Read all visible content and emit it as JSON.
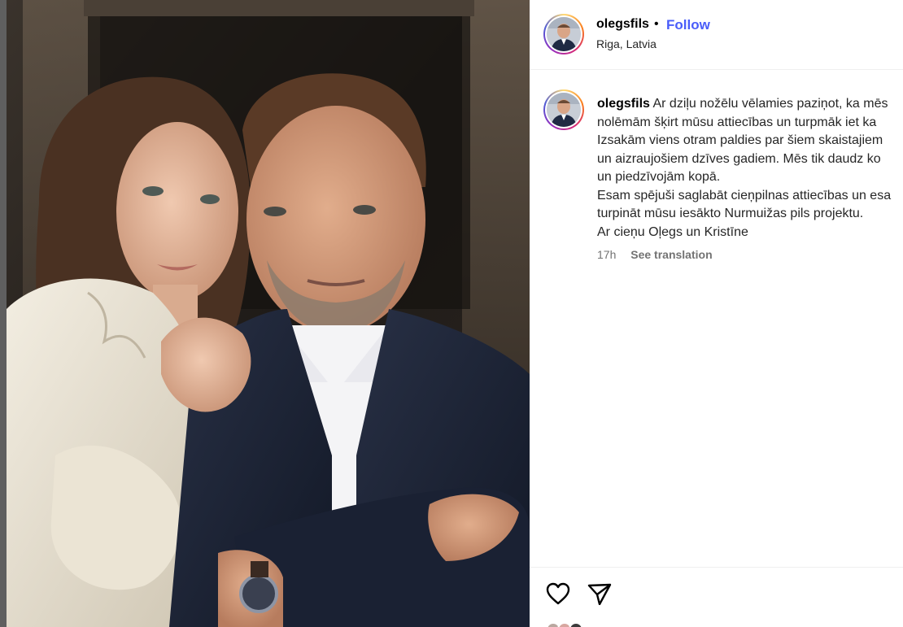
{
  "post": {
    "username": "olegsfils",
    "separator": "•",
    "follow_label": "Follow",
    "location": "Riga, Latvia",
    "caption_lines": [
      "Ar dziļu nožēlu vēlamies paziņot, ka mēs",
      "nolēmām šķirt mūsu attiecības un turpmāk iet ka",
      "Izsakām viens otram paldies par šiem skaistajiem",
      "un aizraujošiem dzīves gadiem. Mēs tik daudz ko",
      "un piedzīvojām kopā.",
      "Esam spējuši saglabāt cieņpilnas attiecības un esa",
      "turpināt mūsu iesākto Nurmuižas pils projektu.",
      "Ar cieņu Oļegs un Kristīne"
    ],
    "time_ago": "17h",
    "see_translation": "See translation"
  },
  "icons": {
    "like": "heart-icon",
    "share": "paper-plane-icon"
  },
  "colors": {
    "follow": "#4a5df9",
    "text": "#262626",
    "muted": "#737373",
    "divider": "#efefef"
  }
}
